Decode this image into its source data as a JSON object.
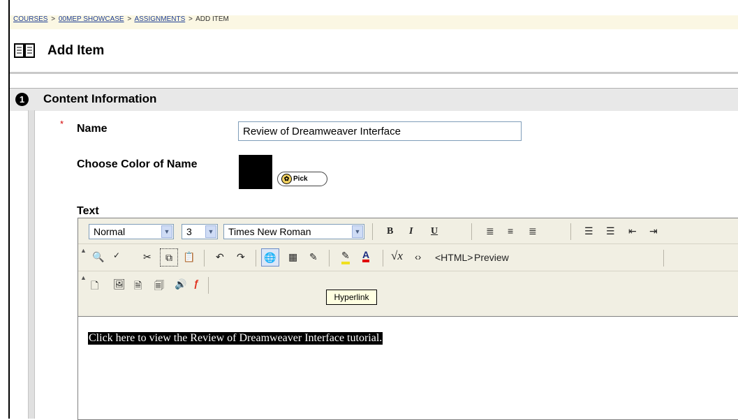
{
  "breadcrumb": {
    "items": [
      "COURSES",
      "00MEP SHOWCASE",
      "ASSIGNMENTS",
      "ADD ITEM"
    ],
    "separator": ">"
  },
  "page": {
    "title": "Add Item",
    "title_icon": "book-icon"
  },
  "section": {
    "number": "1",
    "title": "Content Information"
  },
  "form": {
    "required_marker": "*",
    "name_label": "Name",
    "name_value": "Review of Dreamweaver Interface",
    "color_label": "Choose Color of Name",
    "color_value": "#000000",
    "pick_label": "Pick",
    "text_label": "Text"
  },
  "editor": {
    "format_select": "Normal",
    "size_select": "3",
    "font_select": "Times New Roman",
    "toolbar_row1_buttons": [
      "bold-icon",
      "italic-icon",
      "underline-icon",
      "align-left-icon",
      "align-center-icon",
      "align-right-icon",
      "numbered-list-icon",
      "bulleted-list-icon",
      "outdent-icon",
      "indent-icon"
    ],
    "bold_glyph": "B",
    "italic_glyph": "I",
    "underline_glyph": "U",
    "html_label": "<HTML>",
    "preview_label": "Preview",
    "tooltip": "Hyperlink",
    "content_text": "Click here to view the Review of Dreamweaver Interface tutorial."
  },
  "colors": {
    "breadcrumb_link": "#1f3f95",
    "header_bg": "#fbf7e3",
    "toolbar_bg": "#f1efe3",
    "required": "#d40000"
  }
}
